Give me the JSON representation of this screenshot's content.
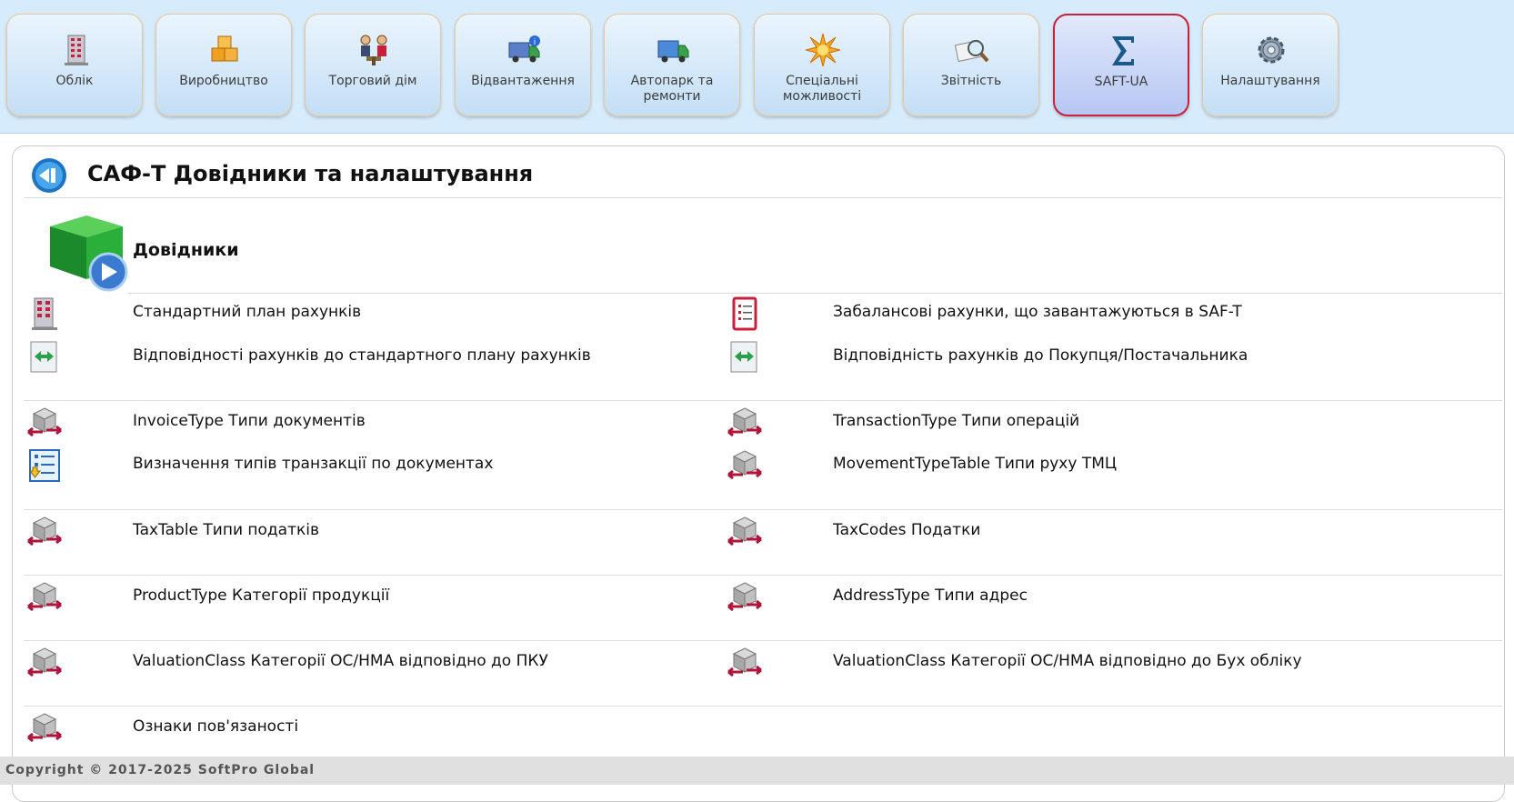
{
  "tabs": [
    {
      "label": "Облік",
      "icon": "ledger-icon"
    },
    {
      "label": "Виробництво",
      "icon": "boxes-icon"
    },
    {
      "label": "Торговий дім",
      "icon": "traders-icon"
    },
    {
      "label": "Відвантаження",
      "icon": "shipping-truck-icon"
    },
    {
      "label": "Автопарк та ремонти",
      "icon": "truck-icon"
    },
    {
      "label": "Спеціальні можливості",
      "icon": "star-burst-icon"
    },
    {
      "label": "Звітність",
      "icon": "report-magnifier-icon"
    },
    {
      "label": "SAFT-UA",
      "icon": "sigma-icon",
      "active": true
    },
    {
      "label": "Налаштування",
      "icon": "gear-icon"
    }
  ],
  "page": {
    "title": "САФ-Т Довідники та налаштування",
    "section_title": "Довідники"
  },
  "items": {
    "left": [
      "Стандартний план рахунків",
      "Відповідності рахунків до стандартного плану рахунків",
      "InvoiceType Типи документів",
      "Визначення типів транзакції по документах",
      "TaxTable Типи податків",
      "ProductType Категорії продукції",
      "ValuationClass Категорії ОС/НМА відповідно до ПКУ",
      "Ознаки пов'язаності"
    ],
    "right": [
      "Забалансові рахунки, що завантажуються в SAF-T",
      "Відповідність рахунків до Покупця/Постачальника",
      "TransactionType Типи операцій",
      "MovementTypeTable Типи руху ТМЦ",
      "TaxCodes Податки",
      "AddressType Типи адрес",
      "ValuationClass Категорії ОС/НМА відповідно до Бух обліку"
    ]
  },
  "footer": "Copyright © 2017-2025 SoftPro Global",
  "colors": {
    "active_border": "#c8203a",
    "tab_border": "#e9c79a",
    "topbar": "#d6ebfb"
  }
}
